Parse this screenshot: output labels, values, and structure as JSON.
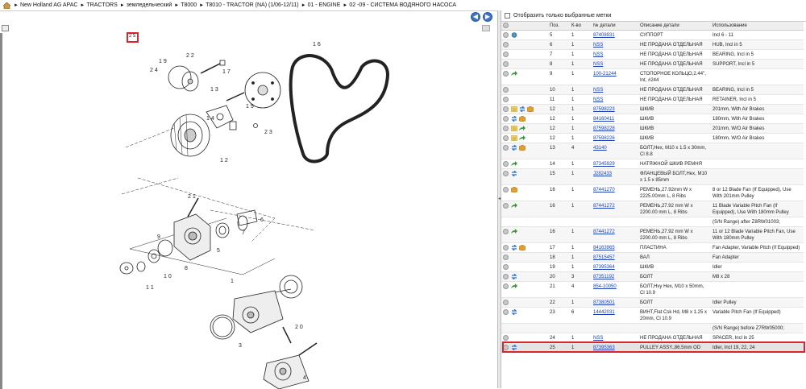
{
  "breadcrumb": [
    "New Holland AG APAC",
    "TRACTORS",
    "земледельческий",
    "T8000",
    "T8010 - TRACTOR (NA) (1/06-12/11)",
    "01 - ENGINE",
    "02 -09 - СИСТЕМА ВОДЯНОГО НАСОСА"
  ],
  "breadcrumb_separator": "►",
  "nav": {
    "back_symbol": "◀",
    "forward_symbol": "▶"
  },
  "filter": {
    "label": "Отобразить только выбранные метки",
    "checked": false
  },
  "diagram": {
    "highlight_label": "2 5",
    "callouts": [
      "1 6",
      "1 9",
      "2 2",
      "2 4",
      "1 7",
      "1 3",
      "1 5",
      "1 4",
      "2 3",
      "1 2",
      "2 1",
      "7",
      "6",
      "5",
      "9",
      "8",
      "1 0",
      "1 1",
      "1",
      "2 0",
      "3",
      "4"
    ]
  },
  "table": {
    "headers": [
      "",
      "Поз.",
      "К-во",
      "№ детали",
      "Описание детали",
      "Использование"
    ],
    "rows": [
      {
        "icons": [
          "circle",
          "globe"
        ],
        "pos": "5",
        "qty": "1",
        "part": "87408931",
        "desc": "СУППОРТ",
        "usage": "Incl 6 - 11"
      },
      {
        "icons": [
          "circle"
        ],
        "pos": "6",
        "qty": "1",
        "part": "NSS",
        "desc": "НЕ ПРОДАНА ОТДЕЛЬНАЯ",
        "usage": "HUB, Incl in 5"
      },
      {
        "icons": [
          "circle"
        ],
        "pos": "7",
        "qty": "1",
        "part": "NSS",
        "desc": "НЕ ПРОДАНА ОТДЕЛЬНАЯ",
        "usage": "BEARING, Incl in 5"
      },
      {
        "icons": [
          "circle"
        ],
        "pos": "8",
        "qty": "1",
        "part": "NSS",
        "desc": "НЕ ПРОДАНА ОТДЕЛЬНАЯ",
        "usage": "SUPPORT, Incl in 5"
      },
      {
        "icons": [
          "circle",
          "arrow-green"
        ],
        "pos": "9",
        "qty": "1",
        "part": "100-21244",
        "desc": "СТОПОРНОЕ КОЛЬЦО,2.44\", Int, #244",
        "usage": ""
      },
      {
        "icons": [
          "circle"
        ],
        "pos": "10",
        "qty": "1",
        "part": "NSS",
        "desc": "НЕ ПРОДАНА ОТДЕЛЬНАЯ",
        "usage": "BEARING, Incl in 5"
      },
      {
        "icons": [
          "circle"
        ],
        "pos": "11",
        "qty": "1",
        "part": "NSS",
        "desc": "НЕ ПРОДАНА ОТДЕЛЬНАЯ",
        "usage": "RETAINER, Incl in 5"
      },
      {
        "icons": [
          "circle",
          "note",
          "swap-blue",
          "box"
        ],
        "pos": "12",
        "qty": "1",
        "part": "87598223",
        "desc": "ШКИВ",
        "usage": "201mm, With Air Brakes"
      },
      {
        "icons": [
          "circle",
          "swap-blue",
          "box"
        ],
        "pos": "12",
        "qty": "1",
        "part": "84160411",
        "desc": "ШКИВ",
        "usage": "180mm, With Air Brakes"
      },
      {
        "icons": [
          "circle",
          "note",
          "arrow-green"
        ],
        "pos": "12",
        "qty": "1",
        "part": "87598228",
        "desc": "ШКИВ",
        "usage": "201mm, W/O Air Brakes"
      },
      {
        "icons": [
          "circle",
          "note",
          "arrow-green"
        ],
        "pos": "12",
        "qty": "1",
        "part": "87598226",
        "desc": "ШКИВ",
        "usage": "180mm, W/O Air Brakes"
      },
      {
        "icons": [
          "circle",
          "swap-blue",
          "box"
        ],
        "pos": "13",
        "qty": "4",
        "part": "43140",
        "desc": "БОЛТ,Hex, M10 x 1.5 x 30mm, Cl 8.8",
        "usage": ""
      },
      {
        "icons": [
          "circle",
          "arrow-green"
        ],
        "pos": "14",
        "qty": "1",
        "part": "87345929",
        "desc": "НАТЯЖНОЙ ШКИВ РЕМНЯ",
        "usage": ""
      },
      {
        "icons": [
          "circle",
          "swap-blue"
        ],
        "pos": "15",
        "qty": "1",
        "part": "J282433",
        "desc": "ФЛАНЦЕВЫЙ БОЛТ,Hex, M10 x 1.5 x 85mm",
        "usage": ""
      },
      {
        "icons": [
          "circle",
          "box"
        ],
        "pos": "16",
        "qty": "1",
        "part": "87441270",
        "desc": "РЕМЕНЬ,27.92mm W x 2225.00mm L, 8 Ribs",
        "usage": "8 or 12 Blade Fan (If Equipped), Use With 201mm Pulley"
      },
      {
        "icons": [
          "circle",
          "arrow-green"
        ],
        "pos": "16",
        "qty": "1",
        "part": "87441272",
        "desc": "РЕМЕНЬ,27.92 mm W x 2200.00 mm L, 8 Ribs",
        "usage": "11 Blade Variable Pitch Fan (If Equipped), Use With 180mm Pulley"
      },
      {
        "icons": [],
        "pos": "",
        "qty": "",
        "part": "",
        "desc": "",
        "usage": "(S/N Range) after Z8RW01003;"
      },
      {
        "icons": [
          "circle",
          "arrow-green"
        ],
        "pos": "16",
        "qty": "1",
        "part": "87441272",
        "desc": "РЕМЕНЬ,27.92 mm W x 2200.00 mm L, 8 Ribs",
        "usage": "11 or 12 Blade Variable Pitch Fan, Use With 180mm Pulley"
      },
      {
        "icons": [
          "circle",
          "swap-blue",
          "box"
        ],
        "pos": "17",
        "qty": "1",
        "part": "84163965",
        "desc": "ПЛАСТИНА",
        "usage": "Fan Adapter, Variable Pitch (If Equipped)"
      },
      {
        "icons": [
          "circle"
        ],
        "pos": "18",
        "qty": "1",
        "part": "87515457",
        "desc": "ВАЛ",
        "usage": "Fan Adapter"
      },
      {
        "icons": [
          "circle"
        ],
        "pos": "19",
        "qty": "1",
        "part": "87395364",
        "desc": "ШКИВ",
        "usage": "Idler"
      },
      {
        "icons": [
          "circle",
          "swap-blue"
        ],
        "pos": "20",
        "qty": "3",
        "part": "87351192",
        "desc": "БОЛТ",
        "usage": "M8 x 28"
      },
      {
        "icons": [
          "circle",
          "arrow-green"
        ],
        "pos": "21",
        "qty": "4",
        "part": "854-10050",
        "desc": "БОЛТ,Hvy Hex, M10 x 50mm, Cl 10.9",
        "usage": ""
      },
      {
        "icons": [
          "circle"
        ],
        "pos": "22",
        "qty": "1",
        "part": "87380501",
        "desc": "БОЛТ",
        "usage": "Idler Pulley"
      },
      {
        "icons": [
          "circle",
          "swap-blue"
        ],
        "pos": "23",
        "qty": "6",
        "part": "14442031",
        "desc": "ВИНТ,Flat Csk Hd, M8 x 1.25 x 20mm, Cl 10.9",
        "usage": "Variable Pitch Fan (If Equipped)"
      },
      {
        "icons": [],
        "pos": "",
        "qty": "",
        "part": "",
        "desc": "",
        "usage": "(S/N Range) before Z7RW05000;"
      },
      {
        "icons": [
          "circle"
        ],
        "pos": "24",
        "qty": "1",
        "part": "NSS",
        "desc": "НЕ ПРОДАНА ОТДЕЛЬНАЯ",
        "usage": "SPACER, Incl in 25"
      },
      {
        "icons": [
          "circle",
          "swap-blue"
        ],
        "pos": "25",
        "qty": "1",
        "part": "87395363",
        "desc": "PULLEY ASSY.,86.5mm OD",
        "usage": "Idler, Incl 19, 22, 24",
        "selected": true
      }
    ]
  },
  "colors": {
    "link": "#1a3fb8",
    "selection": "#d9262c",
    "nav_button": "#3f74c4",
    "arrow_green": "#3a9a3a",
    "swap_blue": "#2f6fc8",
    "box_orange": "#e0a030",
    "note_yellow": "#f0d060"
  }
}
